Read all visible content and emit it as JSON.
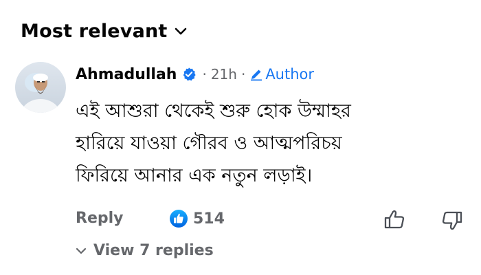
{
  "sort": {
    "label": "Most relevant",
    "chevron_icon": "chevron-down-icon"
  },
  "comment": {
    "avatar_icon": "profile-photo",
    "author": "Ahmadullah",
    "verified_icon": "verified-badge-icon",
    "separator": "·",
    "time": "21h",
    "author_badge": {
      "icon": "pencil-icon",
      "label": "Author"
    },
    "text_lines": [
      "এই আশুরা থেকেই শুরু হোক উম্মাহর",
      "হারিয়ে যাওয়া গৌরব ও আত্মপরিচয়",
      "ফিরিয়ে আনার এক নতুন লড়াই।"
    ]
  },
  "actions": {
    "reply_label": "Reply",
    "reaction_icon": "like-reaction-icon",
    "reaction_count": "514",
    "like_icon": "thumbs-up-icon",
    "dislike_icon": "thumbs-down-icon"
  },
  "replies": {
    "chevron_icon": "chevron-down-icon",
    "label": "View 7 replies"
  },
  "colors": {
    "accent": "#1877f2",
    "secondary_text": "#65676b",
    "primary_text": "#050505"
  }
}
